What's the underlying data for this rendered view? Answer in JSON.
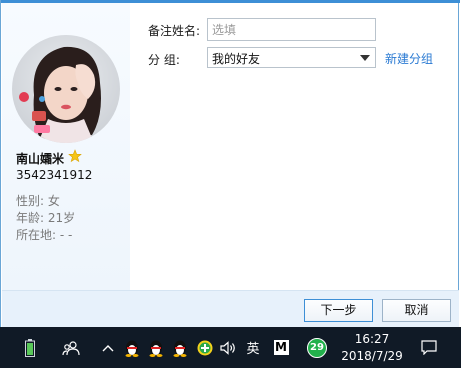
{
  "dialog": {
    "contact": {
      "nickname": "南山孀米",
      "qq_number": "3542341912",
      "gender": "性别: 女",
      "age": "年龄: 21岁",
      "location": "所在地:  -     -"
    },
    "form": {
      "remark_label": "备注姓名:",
      "remark_placeholder": "选填",
      "remark_value": "",
      "group_label": "分      组:",
      "group_selected": "我的好友",
      "new_group_link": "新建分组"
    },
    "buttons": {
      "next": "下一步",
      "cancel": "取消"
    }
  },
  "taskbar": {
    "tray_badge": "29",
    "ime_label": "英",
    "ime_mode": "M",
    "time": "16:27",
    "date": "2018/7/29"
  },
  "colors": {
    "accent": "#3d8fd6",
    "link": "#2a7ad3",
    "taskbar": "#101a26",
    "footer": "#e7f1fb",
    "badge_green": "#22b14c"
  },
  "icons": {
    "battery": "battery-icon",
    "people": "people-icon",
    "chevron": "chevron-up-icon",
    "qq": "qq-penguin-icon",
    "plus": "green-plus-icon",
    "speaker": "speaker-icon",
    "notification": "notification-icon",
    "star": "vip-star-icon"
  }
}
